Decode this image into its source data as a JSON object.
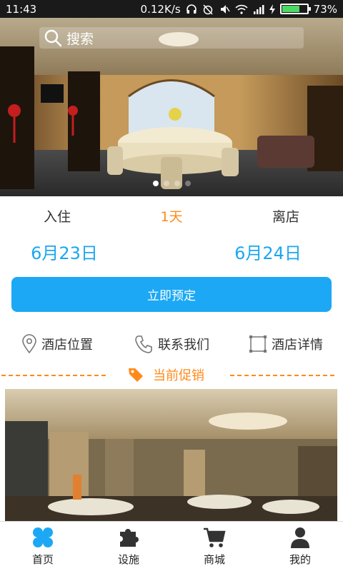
{
  "status_bar": {
    "time": "11:43",
    "network_speed": "0.12K/s",
    "battery": "73%",
    "battery_level": 0.73,
    "icons": [
      "headphones-icon",
      "alarm-off-icon",
      "mute-icon",
      "wifi-icon",
      "signal-icon",
      "charging-icon",
      "battery-icon"
    ]
  },
  "search": {
    "label": "搜索",
    "icon": "search-icon"
  },
  "carousel": {
    "slides": 4,
    "active_index": 0
  },
  "stay": {
    "checkin_label": "入住",
    "nights_label": "1天",
    "checkout_label": "离店",
    "checkin_date": "6月23日",
    "checkout_date": "6月24日"
  },
  "book_button": {
    "label": "立即预定"
  },
  "quick_links": [
    {
      "label": "酒店位置",
      "icon": "location-pin-icon"
    },
    {
      "label": "联系我们",
      "icon": "phone-icon"
    },
    {
      "label": "酒店详情",
      "icon": "details-frame-icon"
    }
  ],
  "promo": {
    "title": "当前促销",
    "icon": "tag-icon"
  },
  "bottom_nav": [
    {
      "label": "首页",
      "icon": "home-clover-icon",
      "active": true
    },
    {
      "label": "设施",
      "icon": "puzzle-icon",
      "active": false
    },
    {
      "label": "商城",
      "icon": "cart-icon",
      "active": false
    },
    {
      "label": "我的",
      "icon": "person-icon",
      "active": false
    }
  ],
  "colors": {
    "accent_blue": "#1ca8f4",
    "accent_orange": "#ff8a1a",
    "status_bar": "#1a1a1a"
  }
}
